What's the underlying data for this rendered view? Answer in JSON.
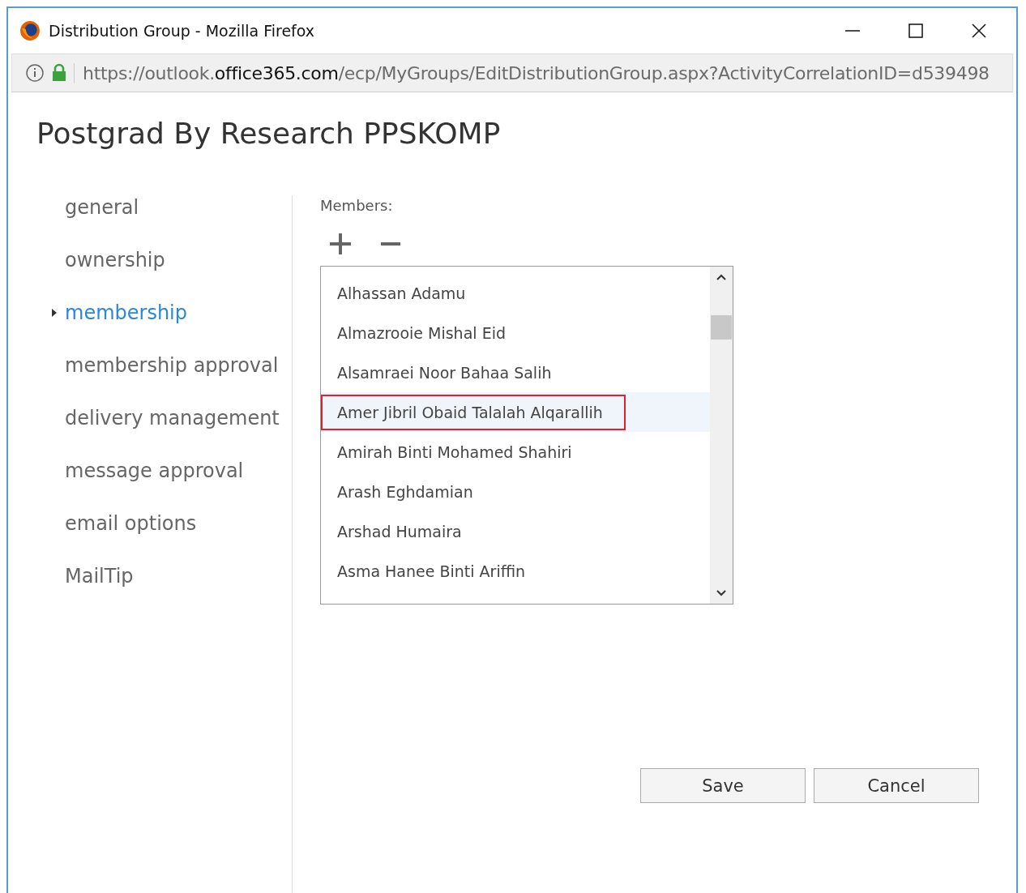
{
  "window": {
    "title": "Distribution Group - Mozilla Firefox"
  },
  "address_bar": {
    "url_prefix": "https://outlook.",
    "url_domain": "office365.com",
    "url_rest": "/ecp/MyGroups/EditDistributionGroup.aspx?ActivityCorrelationID=d539498"
  },
  "page": {
    "title": "Postgrad By Research PPSKOMP"
  },
  "sidebar": {
    "items": [
      {
        "label": "general",
        "selected": false
      },
      {
        "label": "ownership",
        "selected": false
      },
      {
        "label": "membership",
        "selected": true
      },
      {
        "label": "membership approval",
        "selected": false
      },
      {
        "label": "delivery management",
        "selected": false
      },
      {
        "label": "message approval",
        "selected": false
      },
      {
        "label": "email options",
        "selected": false
      },
      {
        "label": "MailTip",
        "selected": false
      }
    ]
  },
  "members": {
    "label": "Members:",
    "items": [
      {
        "name": "Alhassan Adamu",
        "selected": false
      },
      {
        "name": "Almazrooie Mishal Eid",
        "selected": false
      },
      {
        "name": "Alsamraei Noor Bahaa Salih",
        "selected": false
      },
      {
        "name": "Amer Jibril Obaid Talalah Alqarallih",
        "selected": true
      },
      {
        "name": "Amirah Binti Mohamed Shahiri",
        "selected": false
      },
      {
        "name": "Arash Eghdamian",
        "selected": false
      },
      {
        "name": "Arshad Humaira",
        "selected": false
      },
      {
        "name": "Asma Hanee Binti Ariffin",
        "selected": false
      }
    ]
  },
  "buttons": [
    "Save",
    "Cancel"
  ]
}
